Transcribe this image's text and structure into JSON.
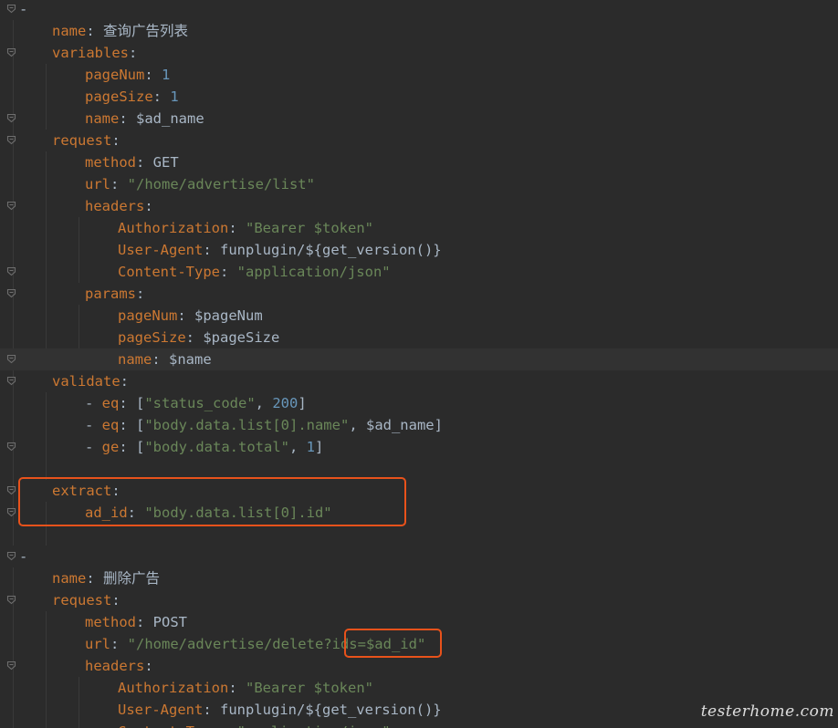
{
  "colors": {
    "background": "#2b2b2b",
    "key": "#cc7832",
    "string": "#6a8759",
    "number": "#6897bb",
    "text": "#a9b7c6",
    "annotation": "#e8521b"
  },
  "lines": [
    {
      "fold": true,
      "indent": 0,
      "tokens": [
        {
          "t": "-",
          "c": "t"
        }
      ]
    },
    {
      "fold": false,
      "indent": 1,
      "tokens": [
        {
          "t": "name",
          "c": "k"
        },
        {
          "t": ": ",
          "c": "t"
        },
        {
          "t": "查询广告列表",
          "c": "t"
        }
      ]
    },
    {
      "fold": true,
      "indent": 1,
      "tokens": [
        {
          "t": "variables",
          "c": "k"
        },
        {
          "t": ":",
          "c": "t"
        }
      ]
    },
    {
      "fold": false,
      "indent": 2,
      "tokens": [
        {
          "t": "pageNum",
          "c": "k"
        },
        {
          "t": ": ",
          "c": "t"
        },
        {
          "t": "1",
          "c": "n"
        }
      ]
    },
    {
      "fold": false,
      "indent": 2,
      "tokens": [
        {
          "t": "pageSize",
          "c": "k"
        },
        {
          "t": ": ",
          "c": "t"
        },
        {
          "t": "1",
          "c": "n"
        }
      ]
    },
    {
      "fold": true,
      "indent": 2,
      "tokens": [
        {
          "t": "name",
          "c": "k"
        },
        {
          "t": ": ",
          "c": "t"
        },
        {
          "t": "$ad_name",
          "c": "t"
        }
      ]
    },
    {
      "fold": true,
      "indent": 1,
      "tokens": [
        {
          "t": "request",
          "c": "k"
        },
        {
          "t": ":",
          "c": "t"
        }
      ]
    },
    {
      "fold": false,
      "indent": 2,
      "tokens": [
        {
          "t": "method",
          "c": "k"
        },
        {
          "t": ": ",
          "c": "t"
        },
        {
          "t": "GET",
          "c": "t"
        }
      ]
    },
    {
      "fold": false,
      "indent": 2,
      "tokens": [
        {
          "t": "url",
          "c": "k"
        },
        {
          "t": ": ",
          "c": "t"
        },
        {
          "t": "\"/home/advertise/list\"",
          "c": "s"
        }
      ]
    },
    {
      "fold": true,
      "indent": 2,
      "tokens": [
        {
          "t": "headers",
          "c": "k"
        },
        {
          "t": ":",
          "c": "t"
        }
      ]
    },
    {
      "fold": false,
      "indent": 3,
      "tokens": [
        {
          "t": "Authorization",
          "c": "k"
        },
        {
          "t": ": ",
          "c": "t"
        },
        {
          "t": "\"Bearer $token\"",
          "c": "s"
        }
      ]
    },
    {
      "fold": false,
      "indent": 3,
      "tokens": [
        {
          "t": "User-Agent",
          "c": "k"
        },
        {
          "t": ": ",
          "c": "t"
        },
        {
          "t": "funplugin/${get_version()}",
          "c": "t"
        }
      ]
    },
    {
      "fold": true,
      "indent": 3,
      "tokens": [
        {
          "t": "Content-Type",
          "c": "k"
        },
        {
          "t": ": ",
          "c": "t"
        },
        {
          "t": "\"application/json\"",
          "c": "s"
        }
      ]
    },
    {
      "fold": true,
      "indent": 2,
      "tokens": [
        {
          "t": "params",
          "c": "k"
        },
        {
          "t": ":",
          "c": "t"
        }
      ]
    },
    {
      "fold": false,
      "indent": 3,
      "tokens": [
        {
          "t": "pageNum",
          "c": "k"
        },
        {
          "t": ": ",
          "c": "t"
        },
        {
          "t": "$pageNum",
          "c": "t"
        }
      ]
    },
    {
      "fold": false,
      "indent": 3,
      "tokens": [
        {
          "t": "pageSize",
          "c": "k"
        },
        {
          "t": ": ",
          "c": "t"
        },
        {
          "t": "$pageSize",
          "c": "t"
        }
      ]
    },
    {
      "fold": true,
      "indent": 3,
      "highlight": true,
      "tokens": [
        {
          "t": "name",
          "c": "k"
        },
        {
          "t": ": ",
          "c": "t"
        },
        {
          "t": "$name",
          "c": "t"
        }
      ]
    },
    {
      "fold": true,
      "indent": 1,
      "tokens": [
        {
          "t": "validate",
          "c": "k"
        },
        {
          "t": ":",
          "c": "t"
        }
      ]
    },
    {
      "fold": false,
      "indent": 2,
      "tokens": [
        {
          "t": "- ",
          "c": "t"
        },
        {
          "t": "eq",
          "c": "k"
        },
        {
          "t": ": [",
          "c": "t"
        },
        {
          "t": "\"status_code\"",
          "c": "s"
        },
        {
          "t": ", ",
          "c": "t"
        },
        {
          "t": "200",
          "c": "n"
        },
        {
          "t": "]",
          "c": "t"
        }
      ]
    },
    {
      "fold": false,
      "indent": 2,
      "tokens": [
        {
          "t": "- ",
          "c": "t"
        },
        {
          "t": "eq",
          "c": "k"
        },
        {
          "t": ": [",
          "c": "t"
        },
        {
          "t": "\"body.data.list[0].name\"",
          "c": "s"
        },
        {
          "t": ", ",
          "c": "t"
        },
        {
          "t": "$ad_name",
          "c": "t"
        },
        {
          "t": "]",
          "c": "t"
        }
      ]
    },
    {
      "fold": true,
      "indent": 2,
      "tokens": [
        {
          "t": "- ",
          "c": "t"
        },
        {
          "t": "ge",
          "c": "k"
        },
        {
          "t": ": [",
          "c": "t"
        },
        {
          "t": "\"body.data.total\"",
          "c": "s"
        },
        {
          "t": ", ",
          "c": "t"
        },
        {
          "t": "1",
          "c": "n"
        },
        {
          "t": "]",
          "c": "t"
        }
      ]
    },
    {
      "fold": false,
      "indent": 0,
      "tokens": []
    },
    {
      "fold": true,
      "indent": 1,
      "tokens": [
        {
          "t": "extract",
          "c": "k"
        },
        {
          "t": ":",
          "c": "t"
        }
      ]
    },
    {
      "fold": true,
      "indent": 2,
      "tokens": [
        {
          "t": "ad_id",
          "c": "k"
        },
        {
          "t": ": ",
          "c": "t"
        },
        {
          "t": "\"body.data.list[0].id\"",
          "c": "s"
        }
      ]
    },
    {
      "fold": false,
      "indent": 0,
      "tokens": []
    },
    {
      "fold": true,
      "indent": 0,
      "tokens": [
        {
          "t": "-",
          "c": "t"
        }
      ]
    },
    {
      "fold": false,
      "indent": 1,
      "tokens": [
        {
          "t": "name",
          "c": "k"
        },
        {
          "t": ": ",
          "c": "t"
        },
        {
          "t": "删除广告",
          "c": "t"
        }
      ]
    },
    {
      "fold": true,
      "indent": 1,
      "tokens": [
        {
          "t": "request",
          "c": "k"
        },
        {
          "t": ":",
          "c": "t"
        }
      ]
    },
    {
      "fold": false,
      "indent": 2,
      "tokens": [
        {
          "t": "method",
          "c": "k"
        },
        {
          "t": ": ",
          "c": "t"
        },
        {
          "t": "POST",
          "c": "t"
        }
      ]
    },
    {
      "fold": false,
      "indent": 2,
      "tokens": [
        {
          "t": "url",
          "c": "k"
        },
        {
          "t": ": ",
          "c": "t"
        },
        {
          "t": "\"/home/advertise/delete?ids=$ad_id\"",
          "c": "s"
        }
      ]
    },
    {
      "fold": true,
      "indent": 2,
      "tokens": [
        {
          "t": "headers",
          "c": "k"
        },
        {
          "t": ":",
          "c": "t"
        }
      ]
    },
    {
      "fold": false,
      "indent": 3,
      "tokens": [
        {
          "t": "Authorization",
          "c": "k"
        },
        {
          "t": ": ",
          "c": "t"
        },
        {
          "t": "\"Bearer $token\"",
          "c": "s"
        }
      ]
    },
    {
      "fold": false,
      "indent": 3,
      "tokens": [
        {
          "t": "User-Agent",
          "c": "k"
        },
        {
          "t": ": ",
          "c": "t"
        },
        {
          "t": "funplugin/${get_version()}",
          "c": "t"
        }
      ]
    },
    {
      "fold": false,
      "indent": 3,
      "tokens": [
        {
          "t": "Content-Type",
          "c": "k"
        },
        {
          "t": ": ",
          "c": "t"
        },
        {
          "t": "\"application/json\"",
          "c": "s"
        }
      ]
    }
  ],
  "watermark": "testerhome.com"
}
